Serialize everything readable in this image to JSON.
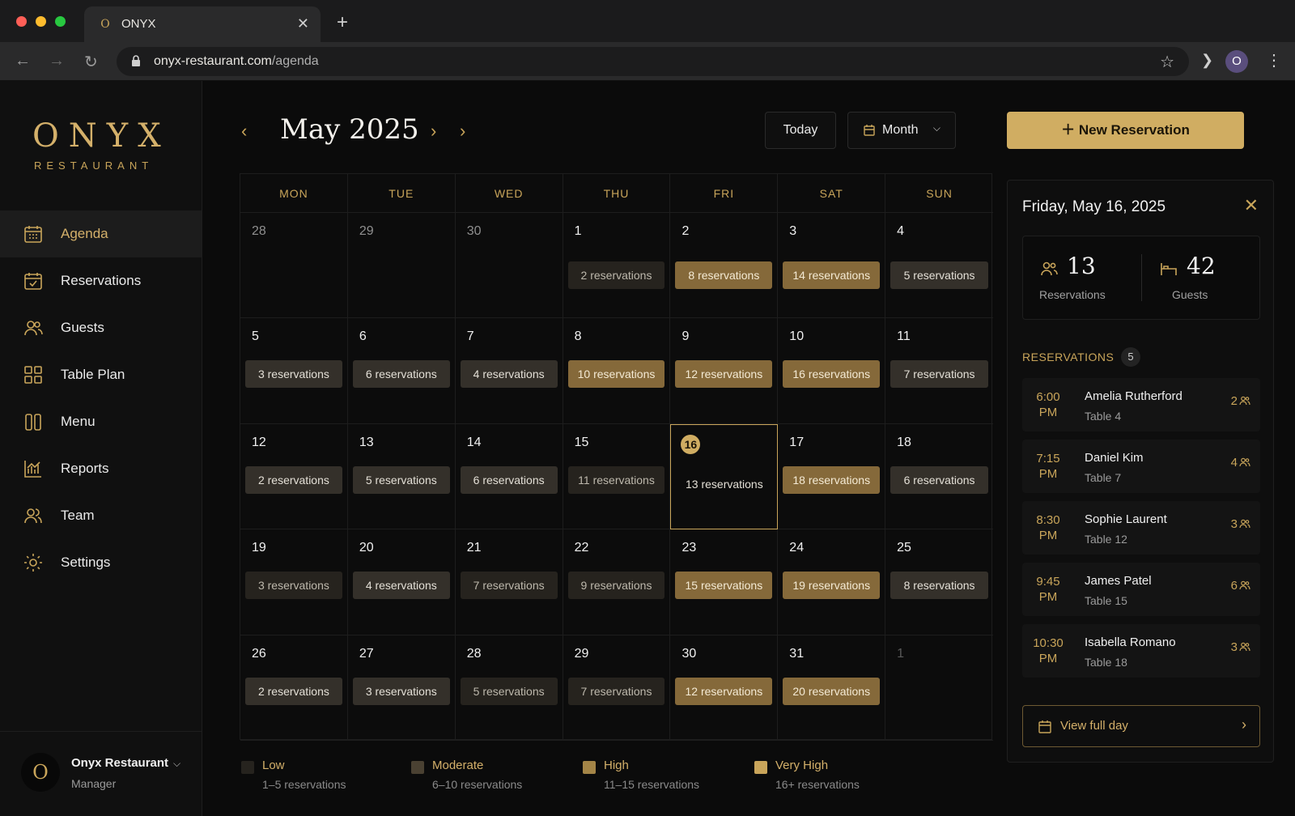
{
  "browser": {
    "tab_title": "ONYX",
    "tab_favicon": "O",
    "url_host": "onyx-restaurant.com",
    "url_path": "/agenda",
    "profile_initial": "O"
  },
  "brand": {
    "name": "ONYX",
    "subtitle": "RESTAURANT"
  },
  "sidebar": {
    "items": [
      {
        "label": "Agenda",
        "icon": "calendar-grid-icon",
        "active": true
      },
      {
        "label": "Reservations",
        "icon": "calendar-check-icon"
      },
      {
        "label": "Guests",
        "icon": "users-icon"
      },
      {
        "label": "Table Plan",
        "icon": "grid-icon"
      },
      {
        "label": "Menu",
        "icon": "menu-book-icon"
      },
      {
        "label": "Reports",
        "icon": "chart-icon"
      },
      {
        "label": "Team",
        "icon": "team-icon"
      },
      {
        "label": "Settings",
        "icon": "gear-icon"
      }
    ],
    "footer": {
      "avatar": "O",
      "name": "Onyx Restaurant",
      "role": "Manager"
    }
  },
  "header": {
    "title": "May 2025",
    "today_label": "Today",
    "view_label": "Month",
    "new_label": "New Reservation"
  },
  "colors": {
    "accent": "#d0ad62",
    "low": "#26231e",
    "moderate": "#34302a",
    "high": "#85693a",
    "very_high": "#a48547"
  },
  "calendar": {
    "weekdays": [
      "MON",
      "TUE",
      "WED",
      "THU",
      "FRI",
      "SAT",
      "SUN"
    ],
    "weeks": [
      [
        {
          "day": "28",
          "state": "other"
        },
        {
          "day": "29",
          "state": "other"
        },
        {
          "day": "30",
          "state": "other"
        },
        {
          "day": "1",
          "reservations": "2 reservations",
          "level": "low"
        },
        {
          "day": "2",
          "reservations": "8 reservations",
          "level": "high"
        },
        {
          "day": "3",
          "reservations": "14 reservations",
          "level": "high"
        },
        {
          "day": "4",
          "reservations": "5 reservations",
          "level": "moderate"
        }
      ],
      [
        {
          "day": "5",
          "reservations": "3 reservations",
          "level": "moderate"
        },
        {
          "day": "6",
          "reservations": "6 reservations",
          "level": "moderate"
        },
        {
          "day": "7",
          "reservations": "4 reservations",
          "level": "moderate"
        },
        {
          "day": "8",
          "reservations": "10 reservations",
          "level": "high"
        },
        {
          "day": "9",
          "reservations": "12 reservations",
          "level": "high"
        },
        {
          "day": "10",
          "reservations": "16 reservations",
          "level": "high"
        },
        {
          "day": "11",
          "reservations": "7 reservations",
          "level": "moderate"
        }
      ],
      [
        {
          "day": "12",
          "reservations": "2 reservations",
          "level": "moderate"
        },
        {
          "day": "13",
          "reservations": "5 reservations",
          "level": "moderate"
        },
        {
          "day": "14",
          "reservations": "6 reservations",
          "level": "moderate"
        },
        {
          "day": "15",
          "reservations": "11 reservations",
          "level": "low"
        },
        {
          "day": "16",
          "reservations": "13 reservations",
          "level": "none",
          "state": "today"
        },
        {
          "day": "17",
          "reservations": "18 reservations",
          "level": "high"
        },
        {
          "day": "18",
          "reservations": "6 reservations",
          "level": "moderate"
        }
      ],
      [
        {
          "day": "19",
          "reservations": "3 reservations",
          "level": "low"
        },
        {
          "day": "20",
          "reservations": "4 reservations",
          "level": "moderate"
        },
        {
          "day": "21",
          "reservations": "7 reservations",
          "level": "low"
        },
        {
          "day": "22",
          "reservations": "9 reservations",
          "level": "low"
        },
        {
          "day": "23",
          "reservations": "15 reservations",
          "level": "high"
        },
        {
          "day": "24",
          "reservations": "19 reservations",
          "level": "high"
        },
        {
          "day": "25",
          "reservations": "8 reservations",
          "level": "moderate"
        }
      ],
      [
        {
          "day": "26",
          "reservations": "2 reservations",
          "level": "moderate"
        },
        {
          "day": "27",
          "reservations": "3 reservations",
          "level": "moderate"
        },
        {
          "day": "28",
          "reservations": "5 reservations",
          "level": "low"
        },
        {
          "day": "29",
          "reservations": "7 reservations",
          "level": "low"
        },
        {
          "day": "30",
          "reservations": "12 reservations",
          "level": "high"
        },
        {
          "day": "31",
          "reservations": "20 reservations",
          "level": "high"
        },
        {
          "day": "1",
          "state": "faded"
        }
      ]
    ]
  },
  "legend": [
    {
      "name": "Low",
      "range": "1–5 reservations",
      "color": "#26231e"
    },
    {
      "name": "Moderate",
      "range": "6–10 reservations",
      "color": "#4a4132"
    },
    {
      "name": "High",
      "range": "11–15 reservations",
      "color": "#a48547"
    },
    {
      "name": "Very High",
      "range": "16+ reservations",
      "color": "#c9a55a"
    }
  ],
  "panel": {
    "title": "Friday, May 16, 2025",
    "stats": [
      {
        "value": "13",
        "label": "Reservations",
        "icon": "users-icon"
      },
      {
        "value": "42",
        "label": "Guests",
        "icon": "bed-icon"
      }
    ],
    "reservations_heading": "RESERVATIONS",
    "reservations_count": "5",
    "reservations": [
      {
        "time": "6:00 PM",
        "name": "Amelia Rutherford",
        "table": "Table 4",
        "party": "2"
      },
      {
        "time": "7:15 PM",
        "name": "Daniel Kim",
        "table": "Table 7",
        "party": "4"
      },
      {
        "time": "8:30 PM",
        "name": "Sophie Laurent",
        "table": "Table 12",
        "party": "3"
      },
      {
        "time": "9:45 PM",
        "name": "James Patel",
        "table": "Table 15",
        "party": "6"
      },
      {
        "time": "10:30 PM",
        "name": "Isabella Romano",
        "table": "Table 18",
        "party": "3"
      }
    ],
    "view_full_day": "View full day"
  }
}
